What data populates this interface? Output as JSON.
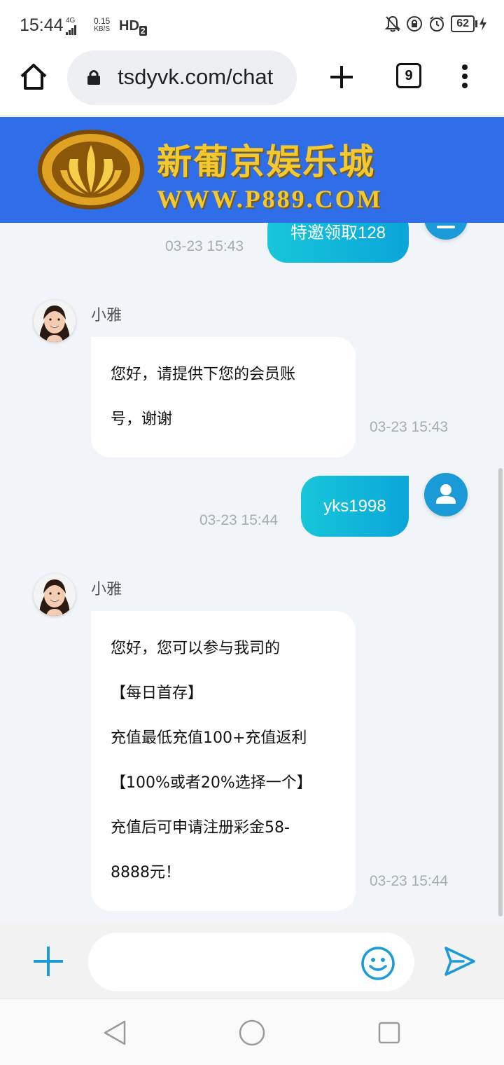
{
  "status_bar": {
    "time": "15:44",
    "network": "4G",
    "speed_value": "0.15",
    "speed_unit": "KB/S",
    "hd": "HD",
    "hd_sub": "2",
    "battery": "62"
  },
  "browser": {
    "url": "tsdyvk.com/chat",
    "tab_count": "9"
  },
  "banner": {
    "title": "新葡京娱乐城",
    "url": "WWW.P889.COM"
  },
  "chat": {
    "messages": [
      {
        "from": "user",
        "text": "特邀领取128",
        "time": "03-23 15:43"
      },
      {
        "from": "agent",
        "name": "小雅",
        "lines": [
          "您好，请提供下您的会员账",
          "号，谢谢"
        ],
        "time": "03-23 15:43"
      },
      {
        "from": "user",
        "text": "yks1998",
        "time": "03-23 15:44"
      },
      {
        "from": "agent",
        "name": "小雅",
        "lines": [
          "您好，您可以参与我司的",
          "【每日首存】",
          "充值最低充值100+充值返利",
          "【100%或者20%选择一个】",
          "充值后可申请注册彩金58-",
          "8888元！"
        ],
        "time": "03-23 15:44"
      }
    ]
  },
  "input": {
    "value": "",
    "placeholder": ""
  },
  "colors": {
    "accent": "#0aa5d9",
    "banner_bg": "#2f6ee8",
    "banner_text": "#f3c830",
    "chat_bg": "#f1f4f8"
  },
  "icons": {
    "home": "home-icon",
    "lock": "lock-icon",
    "new_tab": "plus-icon",
    "menu": "more-vert-icon",
    "user": "user-icon",
    "attach": "plus-icon",
    "emoji": "smiley-icon",
    "send": "send-icon"
  }
}
